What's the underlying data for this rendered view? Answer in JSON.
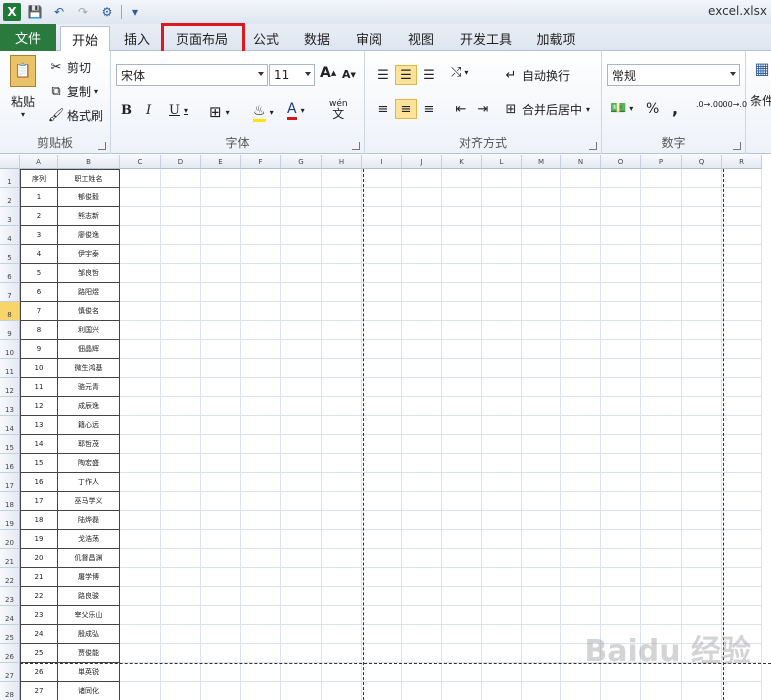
{
  "window": {
    "title": "excel.xlsx"
  },
  "tabs": [
    "文件",
    "开始",
    "插入",
    "页面布局",
    "公式",
    "数据",
    "审阅",
    "视图",
    "开发工具",
    "加载项"
  ],
  "ribbon": {
    "clipboard": {
      "paste": "粘贴",
      "cut": "剪切",
      "copy": "复制",
      "format_painter": "格式刷",
      "label": "剪贴板"
    },
    "font": {
      "name": "宋体",
      "size": "11",
      "label": "字体",
      "bold": "B",
      "italic": "I",
      "underline": "U",
      "grow": "A",
      "shrink": "A",
      "phonetic": "wén"
    },
    "alignment": {
      "wrap": "自动换行",
      "merge": "合并后居中",
      "label": "对齐方式"
    },
    "number": {
      "format": "常规",
      "percent": "%",
      "comma": ",",
      "inc_decimal": ".0→.00",
      "dec_decimal": ".00→.0",
      "label": "数字"
    },
    "styles": {
      "conditional": "条件"
    }
  },
  "sheet": {
    "columns": [
      "A",
      "B",
      "C",
      "D",
      "E",
      "F",
      "G",
      "H",
      "I",
      "J",
      "K",
      "L",
      "M",
      "N",
      "O",
      "P",
      "Q",
      "R"
    ],
    "rows": [
      "1",
      "2",
      "3",
      "4",
      "5",
      "6",
      "7",
      "8",
      "9",
      "10",
      "11",
      "12",
      "13",
      "14",
      "15",
      "16",
      "17",
      "18",
      "19",
      "20",
      "21",
      "22",
      "23",
      "24",
      "25",
      "26",
      "27",
      "28"
    ],
    "active_row": "8",
    "header": {
      "a": "序列",
      "b": "职工姓名"
    },
    "records": [
      [
        "1",
        "郁俊毅"
      ],
      [
        "2",
        "熊志新"
      ],
      [
        "3",
        "廖俊逸"
      ],
      [
        "4",
        "伊宇泰"
      ],
      [
        "5",
        "邹良哲"
      ],
      [
        "6",
        "路阳煜"
      ],
      [
        "7",
        "慎俊名"
      ],
      [
        "8",
        "利国兴"
      ],
      [
        "9",
        "佃晶辉"
      ],
      [
        "10",
        "微生鸿基"
      ],
      [
        "11",
        "骆元青"
      ],
      [
        "12",
        "成辰逸"
      ],
      [
        "13",
        "籍心远"
      ],
      [
        "14",
        "耶哲茂"
      ],
      [
        "15",
        "陶宏盛"
      ],
      [
        "16",
        "丁作人"
      ],
      [
        "17",
        "巫马学义"
      ],
      [
        "18",
        "陆烨磊"
      ],
      [
        "19",
        "戈浩荡"
      ],
      [
        "20",
        "仉督昌渊"
      ],
      [
        "21",
        "屠学博"
      ],
      [
        "22",
        "路良骏"
      ],
      [
        "23",
        "宰父乐山"
      ],
      [
        "24",
        "殷成弘"
      ],
      [
        "25",
        "贾俊能"
      ],
      [
        "26",
        "単英锐"
      ],
      [
        "27",
        "诸同化"
      ]
    ],
    "watermark": "Baidu 经验"
  }
}
